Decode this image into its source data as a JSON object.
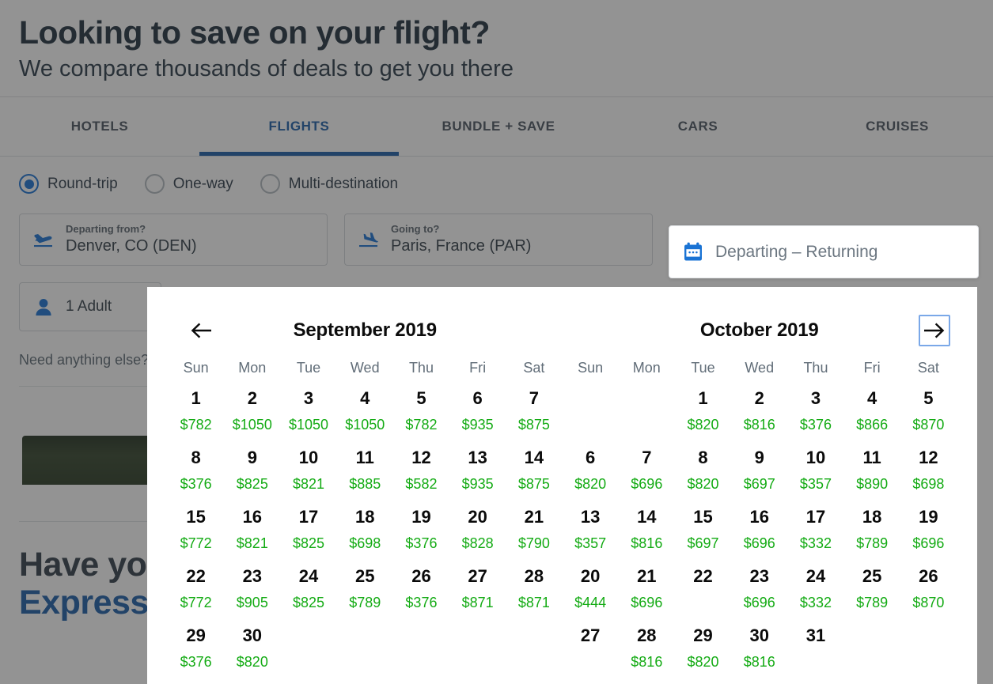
{
  "hero": {
    "title": "Looking to save on your flight?",
    "subtitle": "We compare thousands of deals to get you there"
  },
  "tabs": [
    {
      "label": "HOTELS",
      "active": false
    },
    {
      "label": "FLIGHTS",
      "active": true
    },
    {
      "label": "BUNDLE + SAVE",
      "active": false
    },
    {
      "label": "CARS",
      "active": false
    },
    {
      "label": "CRUISES",
      "active": false
    }
  ],
  "trip_types": [
    {
      "label": "Round-trip",
      "selected": true
    },
    {
      "label": "One-way",
      "selected": false
    },
    {
      "label": "Multi-destination",
      "selected": false
    }
  ],
  "fields": {
    "from": {
      "label": "Departing from?",
      "value": "Denver, CO (DEN)",
      "icon": "plane-departure-icon"
    },
    "to": {
      "label": "Going to?",
      "value": "Paris, France (PAR)",
      "icon": "plane-arrival-icon"
    },
    "dates": {
      "placeholder": "Departing – Returning",
      "value": "",
      "icon": "calendar-icon"
    },
    "travelers": {
      "value": "1 Adult",
      "icon": "person-icon"
    }
  },
  "need_anything_else": "Need anything else?",
  "promo": {
    "line1": "Have your",
    "line2": "Express"
  },
  "calendar": {
    "prev_label": "←",
    "next_label": "→",
    "day_names": [
      "Sun",
      "Mon",
      "Tue",
      "Wed",
      "Thu",
      "Fri",
      "Sat"
    ],
    "currency_symbol": "$",
    "price_color": "#14ab14",
    "months": [
      {
        "title": "September 2019",
        "lead_blanks": 0,
        "days": [
          {
            "day": 1,
            "price": "$782"
          },
          {
            "day": 2,
            "price": "$1050"
          },
          {
            "day": 3,
            "price": "$1050"
          },
          {
            "day": 4,
            "price": "$1050"
          },
          {
            "day": 5,
            "price": "$782"
          },
          {
            "day": 6,
            "price": "$935"
          },
          {
            "day": 7,
            "price": "$875"
          },
          {
            "day": 8,
            "price": "$376"
          },
          {
            "day": 9,
            "price": "$825"
          },
          {
            "day": 10,
            "price": "$821"
          },
          {
            "day": 11,
            "price": "$885"
          },
          {
            "day": 12,
            "price": "$582"
          },
          {
            "day": 13,
            "price": "$935"
          },
          {
            "day": 14,
            "price": "$875"
          },
          {
            "day": 15,
            "price": "$772"
          },
          {
            "day": 16,
            "price": "$821"
          },
          {
            "day": 17,
            "price": "$825"
          },
          {
            "day": 18,
            "price": "$698"
          },
          {
            "day": 19,
            "price": "$376"
          },
          {
            "day": 20,
            "price": "$828"
          },
          {
            "day": 21,
            "price": "$790"
          },
          {
            "day": 22,
            "price": "$772"
          },
          {
            "day": 23,
            "price": "$905"
          },
          {
            "day": 24,
            "price": "$825"
          },
          {
            "day": 25,
            "price": "$789"
          },
          {
            "day": 26,
            "price": "$376"
          },
          {
            "day": 27,
            "price": "$871"
          },
          {
            "day": 28,
            "price": "$871"
          },
          {
            "day": 29,
            "price": "$376"
          },
          {
            "day": 30,
            "price": "$820"
          }
        ]
      },
      {
        "title": "October 2019",
        "lead_blanks": 2,
        "days": [
          {
            "day": 1,
            "price": "$820"
          },
          {
            "day": 2,
            "price": "$816"
          },
          {
            "day": 3,
            "price": "$376"
          },
          {
            "day": 4,
            "price": "$866"
          },
          {
            "day": 5,
            "price": "$870"
          },
          {
            "day": 6,
            "price": "$820"
          },
          {
            "day": 7,
            "price": "$696"
          },
          {
            "day": 8,
            "price": "$820"
          },
          {
            "day": 9,
            "price": "$697"
          },
          {
            "day": 10,
            "price": "$357"
          },
          {
            "day": 11,
            "price": "$890"
          },
          {
            "day": 12,
            "price": "$698"
          },
          {
            "day": 13,
            "price": "$357"
          },
          {
            "day": 14,
            "price": "$816"
          },
          {
            "day": 15,
            "price": "$697"
          },
          {
            "day": 16,
            "price": "$696"
          },
          {
            "day": 17,
            "price": "$332"
          },
          {
            "day": 18,
            "price": "$789"
          },
          {
            "day": 19,
            "price": "$696"
          },
          {
            "day": 20,
            "price": "$444"
          },
          {
            "day": 21,
            "price": "$696"
          },
          {
            "day": 22,
            "price": ""
          },
          {
            "day": 23,
            "price": "$696"
          },
          {
            "day": 24,
            "price": "$332"
          },
          {
            "day": 25,
            "price": "$789"
          },
          {
            "day": 26,
            "price": "$870"
          },
          {
            "day": 27,
            "price": ""
          },
          {
            "day": 28,
            "price": "$816"
          },
          {
            "day": 29,
            "price": "$820"
          },
          {
            "day": 30,
            "price": "$816"
          },
          {
            "day": 31,
            "price": ""
          }
        ]
      }
    ]
  },
  "colors": {
    "brand_blue": "#1d5fa8",
    "accent_blue": "#1a73d4",
    "price_green": "#14ab14",
    "text_dark": "#21303e"
  }
}
